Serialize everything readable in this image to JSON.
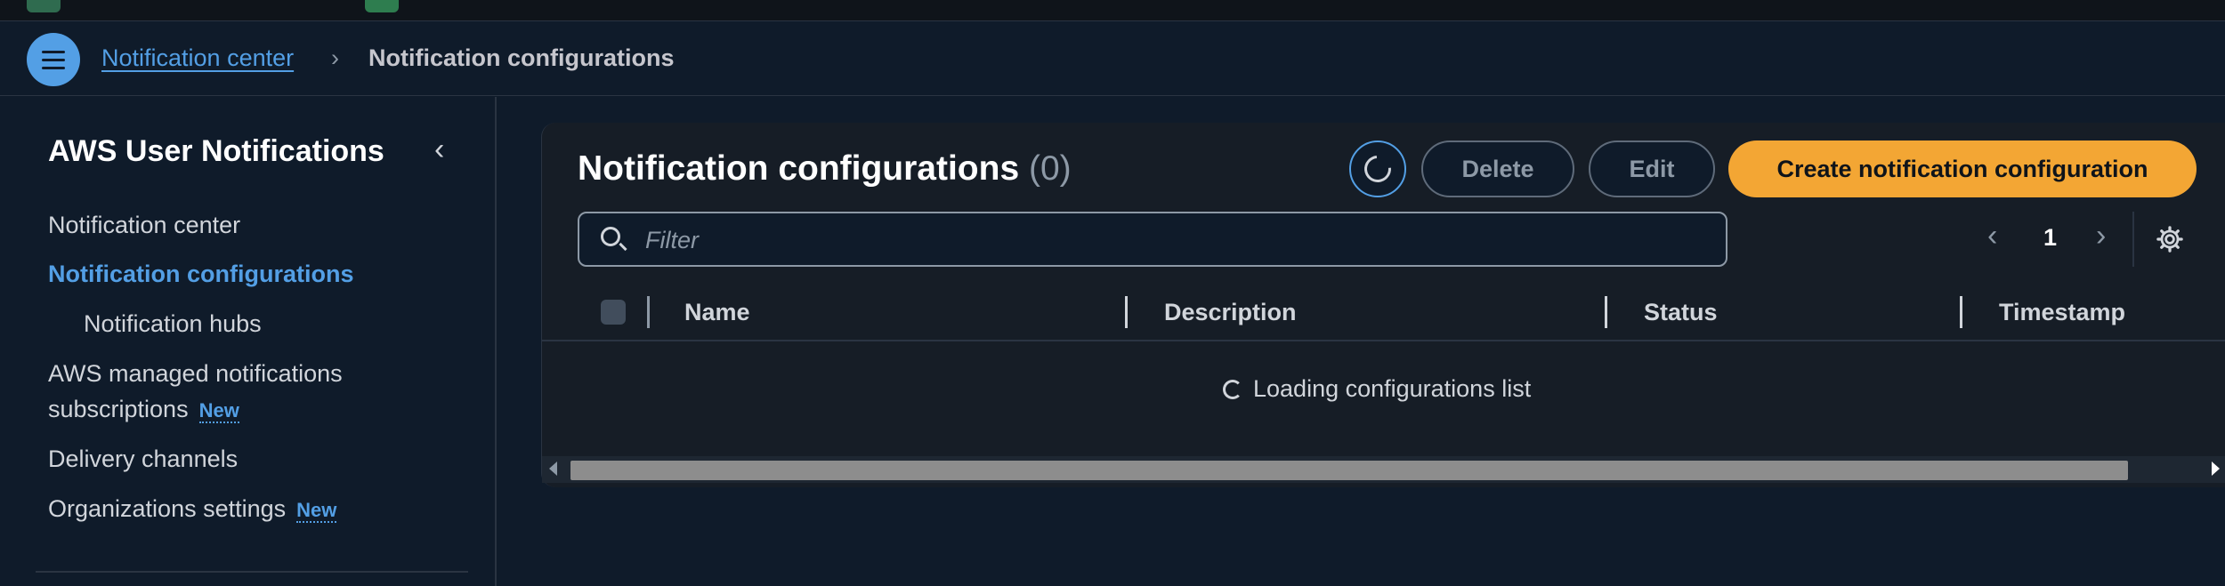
{
  "breadcrumb": {
    "parent": "Notification center",
    "current": "Notification configurations"
  },
  "sidebar": {
    "title": "AWS User Notifications",
    "items": [
      {
        "label": "Notification center"
      },
      {
        "label": "Notification configurations",
        "active": true
      },
      {
        "label": "Notification hubs"
      },
      {
        "label": "AWS managed notifications",
        "label2": "subscriptions",
        "badge": "New"
      },
      {
        "label": "Delivery channels"
      },
      {
        "label": "Organizations settings",
        "badge": "New"
      }
    ]
  },
  "main": {
    "title": "Notification configurations",
    "count": "(0)",
    "buttons": {
      "delete": "Delete",
      "edit": "Edit",
      "create": "Create notification configuration"
    },
    "filter": {
      "placeholder": "Filter"
    },
    "pagination": {
      "current_page": "1"
    },
    "columns": [
      "Name",
      "Description",
      "Status",
      "Timestamp"
    ],
    "loading_text": "Loading configurations list"
  },
  "colors": {
    "accent": "#539fe5",
    "primary_button": "#f3a634",
    "background": "#0f1b2a",
    "panel": "#161d26"
  },
  "icons": [
    "menu-icon",
    "chevron-right-icon",
    "chevron-left-icon",
    "refresh-icon",
    "search-icon",
    "settings-gear-icon",
    "spinner-icon"
  ]
}
